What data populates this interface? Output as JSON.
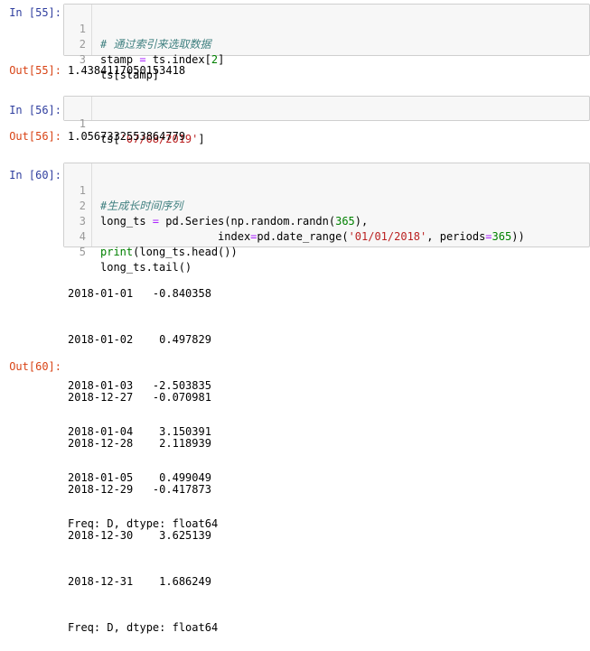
{
  "cells": {
    "c55": {
      "in_prompt": "In [55]:",
      "lines": [
        "1",
        "2",
        "3"
      ],
      "line1": "# 通过索引来选取数据",
      "line2_a": "stamp ",
      "line2_op": "=",
      "line2_b": " ts.index[",
      "line2_num": "2",
      "line2_c": "]",
      "line3": "ts[stamp]",
      "out_prompt": "Out[55]:",
      "out": "1.4384117050153418"
    },
    "c56": {
      "in_prompt": "In [56]:",
      "lines": [
        "1"
      ],
      "line1_a": "ts[",
      "line1_str": "'07/08/2019'",
      "line1_b": "]",
      "out_prompt": "Out[56]:",
      "out": "1.0567332553864779"
    },
    "c60": {
      "in_prompt": "In [60]:",
      "lines": [
        "1",
        "2",
        "3",
        "4",
        "5"
      ],
      "line1": "#生成长时间序列",
      "line2_a": "long_ts ",
      "line2_op": "=",
      "line2_b": " pd.Series(np.random.randn(",
      "line2_num": "365",
      "line2_c": "),",
      "line3_pad": "                  ",
      "line3_a": "index",
      "line3_op": "=",
      "line3_b": "pd.date_range(",
      "line3_str": "'01/01/2018'",
      "line3_c": ", periods",
      "line3_op2": "=",
      "line3_num": "365",
      "line3_d": "))",
      "line4_kw": "print",
      "line4_b": "(long_ts.head())",
      "line5": "long_ts.tail()",
      "stdout": [
        "2018-01-01   -0.840358",
        "2018-01-02    0.497829",
        "2018-01-03   -2.503835",
        "2018-01-04    3.150391",
        "2018-01-05    0.499049",
        "Freq: D, dtype: float64"
      ],
      "out_prompt": "Out[60]:",
      "out": [
        "2018-12-27   -0.070981",
        "2018-12-28    2.118939",
        "2018-12-29   -0.417873",
        "2018-12-30    3.625139",
        "2018-12-31    1.686249",
        "Freq: D, dtype: float64"
      ]
    }
  }
}
